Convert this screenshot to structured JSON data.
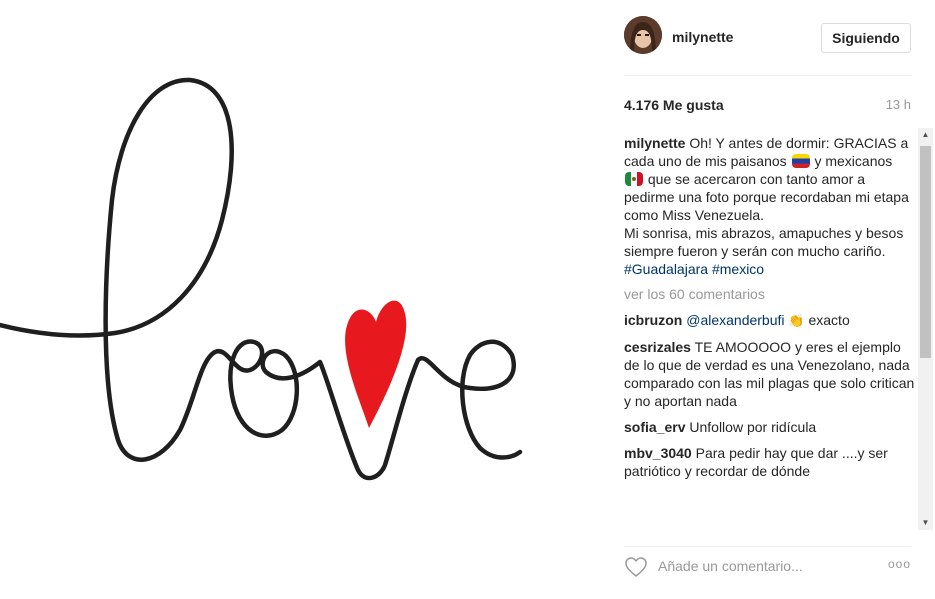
{
  "post": {
    "artwork_alt": "love"
  },
  "header": {
    "username": "milynette",
    "follow_label": "Siguiendo"
  },
  "stats": {
    "likes": "4.176 Me gusta",
    "time": "13 h"
  },
  "caption": {
    "user": "milynette",
    "text_part1": "Oh! Y antes de dormir: GRACIAS a cada uno de mis paisanos",
    "text_part2": "y mexicanos",
    "text_part3": "que se acercaron con tanto amor a pedirme una foto porque recordaban mi etapa como Miss Venezuela.",
    "text_part4": "Mi sonrisa, mis abrazos, amapuches y besos siempre fueron y serán con mucho cariño.",
    "tag1": "#Guadalajara",
    "tag2": "#mexico"
  },
  "view_more": "ver los 60 comentarios",
  "comments": [
    {
      "user": "icbruzon",
      "mention": "@alexanderbufi",
      "text": "exacto"
    },
    {
      "user": "cesrizales",
      "text": "TE AMOOOOO y eres el ejemplo de lo que de verdad es una Venezolano, nada comparado con las mil plagas que solo critican y no aportan nada"
    },
    {
      "user": "sofia_erv",
      "text": "Unfollow por ridícula"
    },
    {
      "user": "mbv_3040",
      "text": "Para pedir hay que dar ....y ser patriótico y recordar de dónde"
    }
  ],
  "footer": {
    "comment_placeholder": "Añade un comentario...",
    "more_options": "ooo"
  },
  "colors": {
    "heart_red": "#e8181f",
    "link_blue": "#003569",
    "ink": "#1f1f1f"
  }
}
